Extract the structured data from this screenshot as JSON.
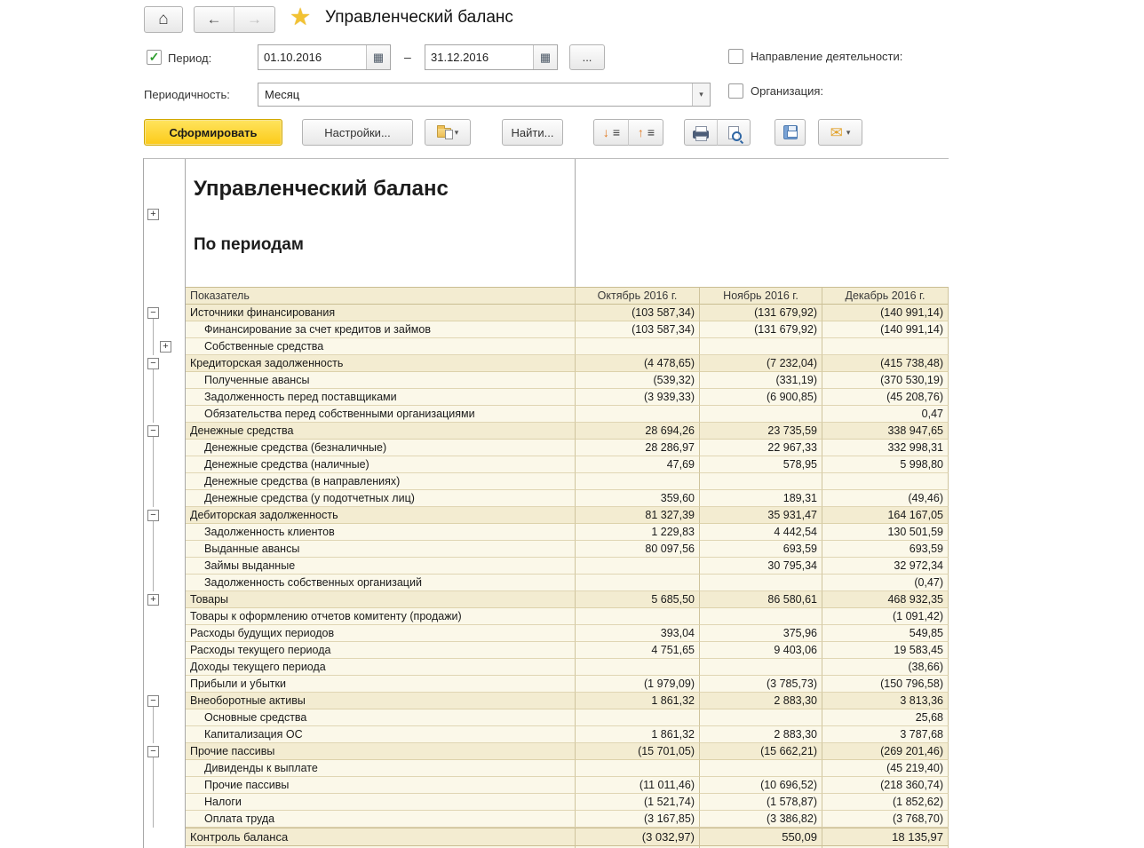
{
  "window": {
    "title": "Управленческий баланс",
    "icons": {
      "home": "⌂",
      "back": "←",
      "forward": "→",
      "star": "★",
      "calendar": "▦",
      "caret": "▾",
      "mail": "✉",
      "arrow_down": "↓",
      "arrow_up": "↑",
      "list": "≡",
      "check": "✓",
      "expander_plus": "+",
      "expander_minus": "−"
    }
  },
  "filters": {
    "period_label": "Период:",
    "period_checked": true,
    "period_from": "01.10.2016",
    "period_to": "31.12.2016",
    "dash": "–",
    "more_button": "...",
    "periodicity_label": "Периодичность:",
    "periodicity_value": "Месяц",
    "direction_label": "Направление деятельности:",
    "organization_label": "Организация:"
  },
  "toolbar": {
    "generate": "Сформировать",
    "settings": "Настройки...",
    "find": "Найти..."
  },
  "report": {
    "title": "Управленческий баланс",
    "subtitle": "По периодам",
    "columns": [
      "Показатель",
      "Октябрь 2016 г.",
      "Ноябрь 2016 г.",
      "Декабрь 2016 г."
    ],
    "rows": [
      {
        "label": "Источники финансирования",
        "tree": "minus",
        "indent": 0,
        "group": true,
        "values": [
          "(103 587,34)",
          "(131 679,92)",
          "(140 991,14)"
        ]
      },
      {
        "label": "Финансирование за счет кредитов и займов",
        "tree": "line",
        "indent": 1,
        "group": false,
        "values": [
          "(103 587,34)",
          "(131 679,92)",
          "(140 991,14)"
        ]
      },
      {
        "label": "Собственные средства",
        "tree": "plus2",
        "indent": 1,
        "group": false,
        "values": [
          "",
          "",
          ""
        ]
      },
      {
        "label": "Кредиторская задолженность",
        "tree": "minus",
        "indent": 0,
        "group": true,
        "values": [
          "(4 478,65)",
          "(7 232,04)",
          "(415 738,48)"
        ]
      },
      {
        "label": "Полученные авансы",
        "tree": "line",
        "indent": 1,
        "group": false,
        "values": [
          "(539,32)",
          "(331,19)",
          "(370 530,19)"
        ]
      },
      {
        "label": "Задолженность перед поставщиками",
        "tree": "line",
        "indent": 1,
        "group": false,
        "values": [
          "(3 939,33)",
          "(6 900,85)",
          "(45 208,76)"
        ]
      },
      {
        "label": "Обязательства перед собственными организациями",
        "tree": "line",
        "indent": 1,
        "group": false,
        "values": [
          "",
          "",
          "0,47"
        ]
      },
      {
        "label": "Денежные средства",
        "tree": "minus",
        "indent": 0,
        "group": true,
        "values": [
          "28 694,26",
          "23 735,59",
          "338 947,65"
        ]
      },
      {
        "label": "Денежные средства (безналичные)",
        "tree": "line",
        "indent": 1,
        "group": false,
        "values": [
          "28 286,97",
          "22 967,33",
          "332 998,31"
        ]
      },
      {
        "label": "Денежные средства (наличные)",
        "tree": "line",
        "indent": 1,
        "group": false,
        "values": [
          "47,69",
          "578,95",
          "5 998,80"
        ]
      },
      {
        "label": "Денежные средства (в направлениях)",
        "tree": "line",
        "indent": 1,
        "group": false,
        "values": [
          "",
          "",
          ""
        ]
      },
      {
        "label": "Денежные средства (у подотчетных лиц)",
        "tree": "line",
        "indent": 1,
        "group": false,
        "values": [
          "359,60",
          "189,31",
          "(49,46)"
        ]
      },
      {
        "label": "Дебиторская задолженность",
        "tree": "minus",
        "indent": 0,
        "group": true,
        "values": [
          "81 327,39",
          "35 931,47",
          "164 167,05"
        ]
      },
      {
        "label": "Задолженность клиентов",
        "tree": "line",
        "indent": 1,
        "group": false,
        "values": [
          "1 229,83",
          "4 442,54",
          "130 501,59"
        ]
      },
      {
        "label": "Выданные авансы",
        "tree": "line",
        "indent": 1,
        "group": false,
        "values": [
          "80 097,56",
          "693,59",
          "693,59"
        ]
      },
      {
        "label": "Займы выданные",
        "tree": "line",
        "indent": 1,
        "group": false,
        "values": [
          "",
          "30 795,34",
          "32 972,34"
        ]
      },
      {
        "label": "Задолженность собственных организаций",
        "tree": "line",
        "indent": 1,
        "group": false,
        "values": [
          "",
          "",
          "(0,47)"
        ]
      },
      {
        "label": "Товары",
        "tree": "plus",
        "indent": 0,
        "group": true,
        "values": [
          "5 685,50",
          "86 580,61",
          "468 932,35"
        ]
      },
      {
        "label": "Товары к оформлению отчетов комитенту (продажи)",
        "tree": null,
        "indent": 0,
        "group": false,
        "values": [
          "",
          "",
          "(1 091,42)"
        ]
      },
      {
        "label": "Расходы будущих периодов",
        "tree": null,
        "indent": 0,
        "group": false,
        "values": [
          "393,04",
          "375,96",
          "549,85"
        ]
      },
      {
        "label": "Расходы текущего периода",
        "tree": null,
        "indent": 0,
        "group": false,
        "values": [
          "4 751,65",
          "9 403,06",
          "19 583,45"
        ]
      },
      {
        "label": "Доходы текущего периода",
        "tree": null,
        "indent": 0,
        "group": false,
        "values": [
          "",
          "",
          "(38,66)"
        ]
      },
      {
        "label": "Прибыли и убытки",
        "tree": null,
        "indent": 0,
        "group": false,
        "values": [
          "(1 979,09)",
          "(3 785,73)",
          "(150 796,58)"
        ]
      },
      {
        "label": "Внеоборотные активы",
        "tree": "minus",
        "indent": 0,
        "group": true,
        "values": [
          "1 861,32",
          "2 883,30",
          "3 813,36"
        ]
      },
      {
        "label": "Основные средства",
        "tree": "line",
        "indent": 1,
        "group": false,
        "values": [
          "",
          "",
          "25,68"
        ]
      },
      {
        "label": "Капитализация ОС",
        "tree": "line",
        "indent": 1,
        "group": false,
        "values": [
          "1 861,32",
          "2 883,30",
          "3 787,68"
        ]
      },
      {
        "label": "Прочие пассивы",
        "tree": "minus",
        "indent": 0,
        "group": true,
        "values": [
          "(15 701,05)",
          "(15 662,21)",
          "(269 201,46)"
        ]
      },
      {
        "label": "Дивиденды к выплате",
        "tree": "line",
        "indent": 1,
        "group": false,
        "values": [
          "",
          "",
          "(45 219,40)"
        ]
      },
      {
        "label": "Прочие пассивы",
        "tree": "line",
        "indent": 1,
        "group": false,
        "values": [
          "(11 011,46)",
          "(10 696,52)",
          "(218 360,74)"
        ]
      },
      {
        "label": "Налоги",
        "tree": "line",
        "indent": 1,
        "group": false,
        "values": [
          "(1 521,74)",
          "(1 578,87)",
          "(1 852,62)"
        ]
      },
      {
        "label": "Оплата труда",
        "tree": "line",
        "indent": 1,
        "group": false,
        "values": [
          "(3 167,85)",
          "(3 386,82)",
          "(3 768,70)"
        ]
      },
      {
        "label": "Контроль баланса",
        "tree": null,
        "indent": 0,
        "group": false,
        "footer": true,
        "values": [
          "(3 032,97)",
          "550,09",
          "18 135,97"
        ]
      }
    ]
  }
}
